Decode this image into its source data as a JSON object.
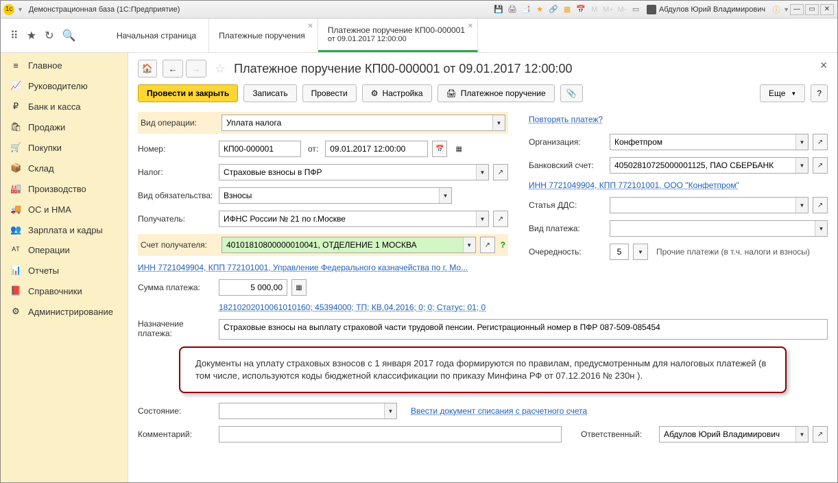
{
  "titlebar": {
    "title": "Демонстрационная база  (1С:Предприятие)",
    "user": "Абдулов Юрий Владимирович"
  },
  "tabs": [
    {
      "label": "Начальная страница"
    },
    {
      "label": "Платежные поручения"
    },
    {
      "line1": "Платежное поручение КП00-000001",
      "line2": "от 09.01.2017 12:00:00"
    }
  ],
  "sidebar": [
    {
      "icon": "≡",
      "label": "Главное"
    },
    {
      "icon": "📈",
      "label": "Руководителю"
    },
    {
      "icon": "₽",
      "label": "Банк и касса"
    },
    {
      "icon": "🛍",
      "label": "Продажи"
    },
    {
      "icon": "🛒",
      "label": "Покупки"
    },
    {
      "icon": "📦",
      "label": "Склад"
    },
    {
      "icon": "🏭",
      "label": "Производство"
    },
    {
      "icon": "🚚",
      "label": "ОС и НМА"
    },
    {
      "icon": "👥",
      "label": "Зарплата и кадры"
    },
    {
      "icon": "ᴬᵀ",
      "label": "Операции"
    },
    {
      "icon": "📊",
      "label": "Отчеты"
    },
    {
      "icon": "📕",
      "label": "Справочники"
    },
    {
      "icon": "⚙",
      "label": "Администрирование"
    }
  ],
  "doc": {
    "title": "Платежное поручение КП00-000001 от 09.01.2017 12:00:00",
    "toolbar": {
      "post_close": "Провести и закрыть",
      "save": "Записать",
      "post": "Провести",
      "settings": "Настройка",
      "payment_order": "Платежное поручение",
      "more": "Еще",
      "help": "?"
    },
    "labels": {
      "operation_type": "Вид операции:",
      "number": "Номер:",
      "from": "от:",
      "tax": "Налог:",
      "obligation_type": "Вид обязательства:",
      "recipient": "Получатель:",
      "recipient_account": "Счет получателя:",
      "payment_sum": "Сумма платежа:",
      "payment_purpose": "Назначение платежа:",
      "state": "Состояние:",
      "comment": "Комментарий:",
      "organization": "Организация:",
      "bank_account": "Банковский счет:",
      "dds_article": "Статья ДДС:",
      "payment_type": "Вид платежа:",
      "priority": "Очередность:",
      "responsible": "Ответственный:"
    },
    "values": {
      "operation_type": "Уплата налога",
      "number": "КП00-000001",
      "date": "09.01.2017 12:00:00",
      "tax": "Страховые взносы в ПФР",
      "obligation_type": "Взносы",
      "recipient": "ИФНС России № 21 по г.Москве",
      "recipient_account": "40101810800000010041, ОТДЕЛЕНИЕ 1 МОСКВА",
      "sum": "5 000,00",
      "purpose": "Страховые взносы на выплату страховой части трудовой пенсии. Регистрационный номер в ПФР 087-509-085454",
      "state": "",
      "comment": "",
      "organization": "Конфетпром",
      "bank_account": "40502810725000001125, ПАО СБЕРБАНК",
      "dds": "",
      "payment_type": "",
      "priority": "5",
      "priority_hint": "Прочие платежи (в т.ч. налоги и взносы)",
      "responsible": "Абдулов Юрий Владимирович"
    },
    "links": {
      "repeat": "Повторять платеж?",
      "org_details": "ИНН 7721049904, КПП 772101001, ООО \"Конфетпром\"",
      "recipient_details": "ИНН 7721049904, КПП 772101001, Управление Федерального казначейства по г. Мо...",
      "kbk_line": "18210202010061010160; 45394000; ТП; КВ.04.2016; 0; 0; Статус: 01; 0",
      "write_off": "Ввести документ списания с расчетного счета"
    },
    "callout": "Документы на уплату страховых взносов с 1 января 2017 года формируются по правилам, предусмотренным для налоговых платежей (в том числе, используются коды бюджетной классификации по приказу Минфина РФ от 07.12.2016 № 230н )."
  }
}
